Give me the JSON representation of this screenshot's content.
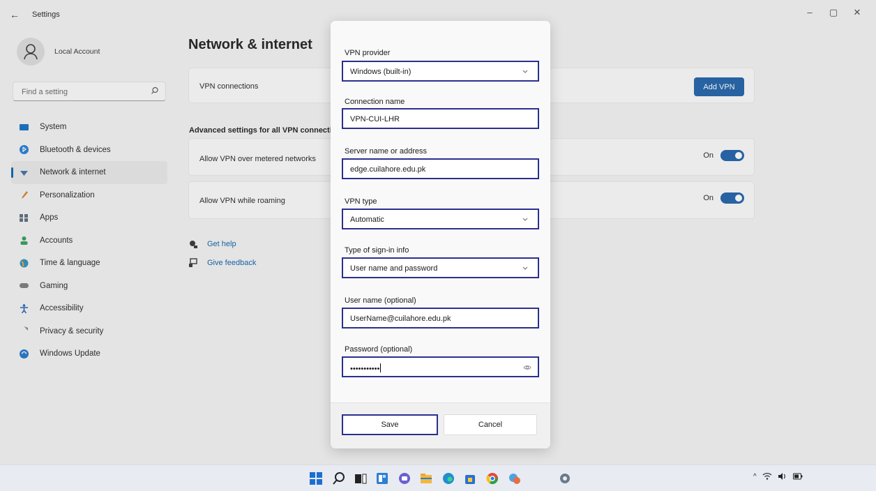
{
  "window": {
    "app_title": "Settings",
    "back_glyph": "←",
    "min_glyph": "–",
    "max_glyph": "▢",
    "close_glyph": "✕"
  },
  "profile": {
    "name": "Local Account"
  },
  "search": {
    "placeholder": "Find a setting"
  },
  "sidebar": {
    "items": [
      {
        "label": "System",
        "icon": "monitor-icon",
        "color": "#0e6dc2"
      },
      {
        "label": "Bluetooth & devices",
        "icon": "bluetooth-icon",
        "color": "#1f7ad6"
      },
      {
        "label": "Network & internet",
        "icon": "wifi-icon",
        "color": "#3a6ea8"
      },
      {
        "label": "Personalization",
        "icon": "brush-icon",
        "color": "#d9822b"
      },
      {
        "label": "Apps",
        "icon": "apps-icon",
        "color": "#5b6b7a"
      },
      {
        "label": "Accounts",
        "icon": "person-icon",
        "color": "#2f9d58"
      },
      {
        "label": "Time & language",
        "icon": "globe-icon",
        "color": "#2a8fb8"
      },
      {
        "label": "Gaming",
        "icon": "gamepad-icon",
        "color": "#7a7a7a"
      },
      {
        "label": "Accessibility",
        "icon": "accessibility-icon",
        "color": "#1d5fb3"
      },
      {
        "label": "Privacy & security",
        "icon": "shield-icon",
        "color": "#7d7d7d"
      },
      {
        "label": "Windows Update",
        "icon": "update-icon",
        "color": "#1f72c9"
      }
    ],
    "active_index": 2
  },
  "main": {
    "title": "Network & internet",
    "vpn_connections_label": "VPN connections",
    "add_vpn_label": "Add VPN",
    "advanced_header": "Advanced settings for all VPN connectio",
    "metered_label": "Allow VPN over metered networks",
    "metered_state": "On",
    "roaming_label": "Allow VPN while roaming",
    "roaming_state": "On",
    "get_help": "Get help",
    "give_feedback": "Give feedback"
  },
  "dialog": {
    "provider_label": "VPN provider",
    "provider_value": "Windows (built-in)",
    "conn_name_label": "Connection name",
    "conn_name_value": "VPN-CUI-LHR",
    "server_label": "Server name or address",
    "server_value": "edge.cuilahore.edu.pk",
    "vpn_type_label": "VPN type",
    "vpn_type_value": "Automatic",
    "signin_label": "Type of sign-in info",
    "signin_value": "User name and password",
    "username_label": "User name (optional)",
    "username_value": "UserName@cuilahore.edu.pk",
    "password_label": "Password (optional)",
    "password_value": "•••••••••••",
    "save_label": "Save",
    "cancel_label": "Cancel"
  },
  "taskbar": {
    "icons": [
      "start-icon",
      "search-icon",
      "task-view-icon",
      "widgets-icon",
      "chat-icon",
      "file-explorer-icon",
      "edge-icon",
      "store-icon",
      "chrome-icon",
      "app-icon",
      "settings-icon"
    ],
    "tray_chevron": "^",
    "colors": {
      "accent": "#1c5fa8",
      "highlight_border": "#2b2f8e"
    }
  }
}
